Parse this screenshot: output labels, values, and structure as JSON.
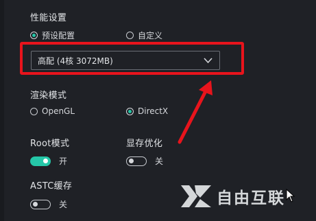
{
  "performance": {
    "title": "性能设置",
    "options": [
      {
        "label": "预设配置",
        "checked": true
      },
      {
        "label": "自定义",
        "checked": false
      }
    ],
    "preset_value": "高配 (4核 3072MB)"
  },
  "render": {
    "title": "渲染模式",
    "options": [
      {
        "label": "OpenGL",
        "checked": false
      },
      {
        "label": "DirectX",
        "checked": true
      }
    ]
  },
  "root_mode": {
    "title": "Root模式",
    "state_label": "开",
    "on": true
  },
  "vram_opt": {
    "title": "显存优化",
    "state_label": "关",
    "on": false
  },
  "astc_cache": {
    "title": "ASTC缓存",
    "state_label": "关",
    "on": false
  },
  "watermark": {
    "text": "自由互联"
  },
  "colors": {
    "accent": "#25c7a8",
    "highlight_box": "#e8141c",
    "background": "#1f2126"
  }
}
